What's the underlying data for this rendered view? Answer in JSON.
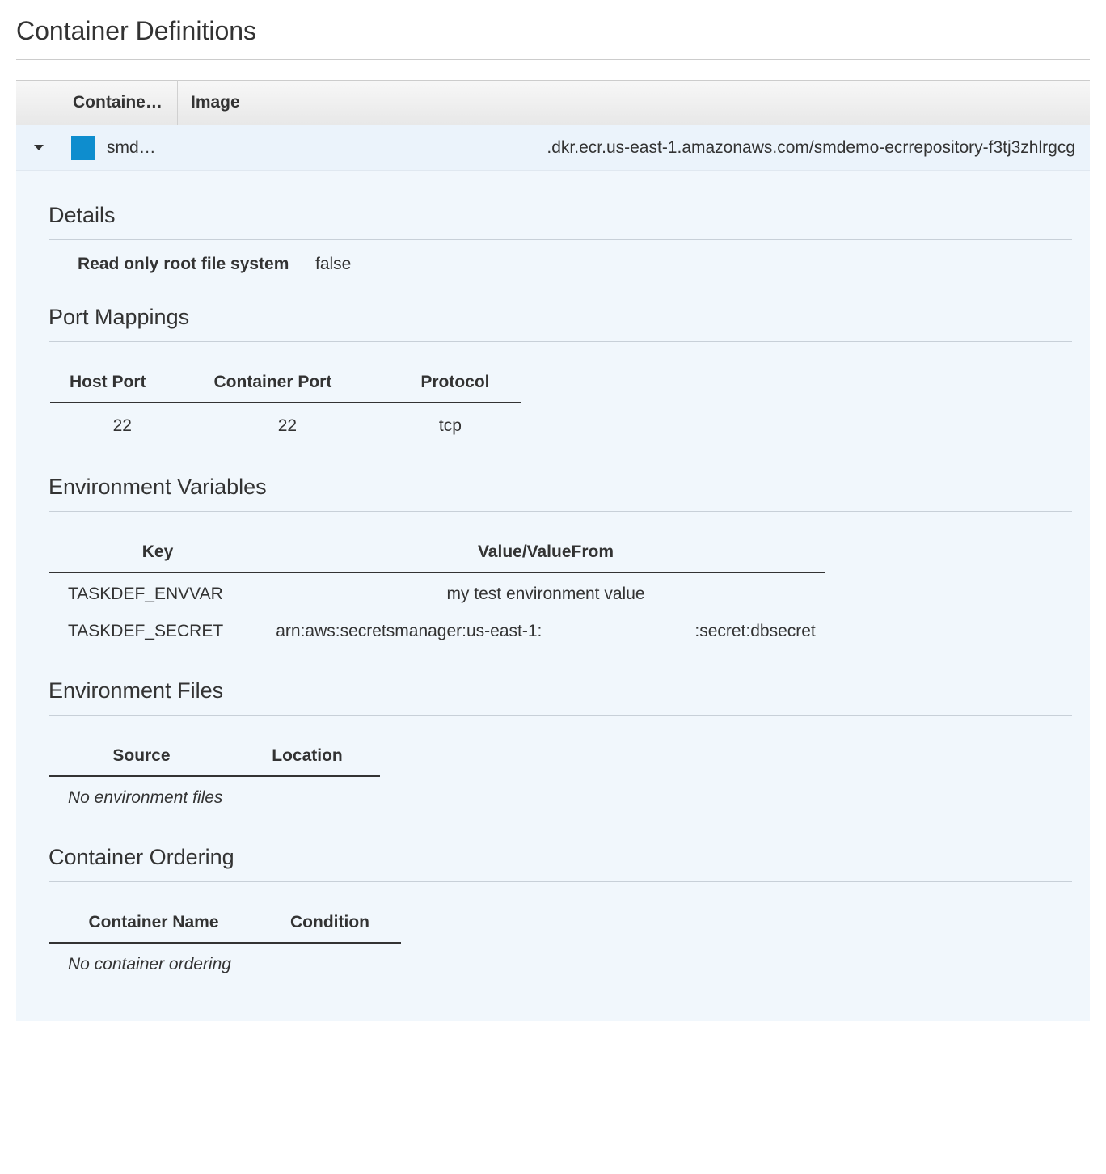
{
  "page": {
    "title": "Container Definitions"
  },
  "table": {
    "headers": {
      "container": "Containe…",
      "image": "Image"
    },
    "row": {
      "container": "smd…",
      "image": ".dkr.ecr.us-east-1.amazonaws.com/smdemo-ecrrepository-f3tj3zhlrgcg"
    }
  },
  "details": {
    "title": "Details",
    "readonly_label": "Read only root file system",
    "readonly_value": "false"
  },
  "port_mappings": {
    "title": "Port Mappings",
    "headers": {
      "host_port": "Host Port",
      "container_port": "Container Port",
      "protocol": "Protocol"
    },
    "rows": [
      {
        "host_port": "22",
        "container_port": "22",
        "protocol": "tcp"
      }
    ]
  },
  "env_vars": {
    "title": "Environment Variables",
    "headers": {
      "key": "Key",
      "value": "Value/ValueFrom"
    },
    "rows": [
      {
        "key": "TASKDEF_ENVVAR",
        "value": "my test environment value"
      },
      {
        "key": "TASKDEF_SECRET",
        "value": "arn:aws:secretsmanager:us-east-1:         :secret:dbsecret"
      }
    ]
  },
  "env_files": {
    "title": "Environment Files",
    "headers": {
      "source": "Source",
      "location": "Location"
    },
    "empty": "No environment files"
  },
  "ordering": {
    "title": "Container Ordering",
    "headers": {
      "name": "Container Name",
      "condition": "Condition"
    },
    "empty": "No container ordering"
  }
}
